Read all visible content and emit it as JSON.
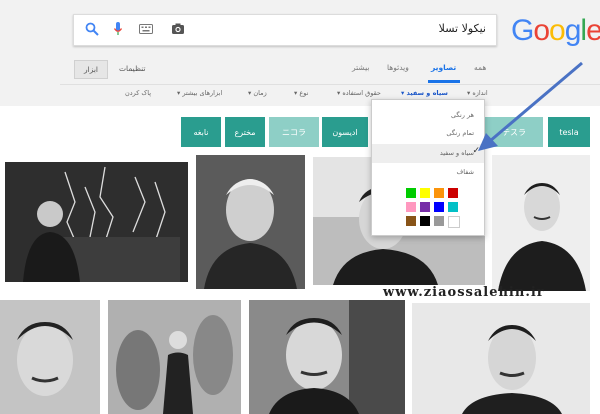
{
  "search": {
    "query": "نیکولا تسلا"
  },
  "logo": {
    "text": "Google"
  },
  "tabs": [
    {
      "label": "همه"
    },
    {
      "label": "تصاویر"
    },
    {
      "label": "ویدئوها"
    },
    {
      "label": "بیشتر"
    }
  ],
  "settings_label": "تنظیمات",
  "tools_label": "ابزار",
  "tools_row": [
    {
      "label": "اندازه ▾"
    },
    {
      "label": "سیاه و سفید ▾"
    },
    {
      "label": "حقوق استفاده ▾"
    },
    {
      "label": "نوع ▾"
    },
    {
      "label": "زمان ▾"
    },
    {
      "label": "ابزارهای بیشتر ▾"
    },
    {
      "label": "پاک کردن"
    }
  ],
  "chips": [
    {
      "label": "tesla"
    },
    {
      "label": "テスラ"
    },
    {
      "label": "ادیسون"
    },
    {
      "label": "ニコラ"
    },
    {
      "label": "مخترع"
    },
    {
      "label": "نابغه"
    }
  ],
  "dropdown": {
    "items": [
      {
        "label": "هر رنگی"
      },
      {
        "label": "تمام رنگی"
      },
      {
        "label": "سیاه و سفید"
      },
      {
        "label": "شفاف"
      }
    ],
    "checkmark": "✓",
    "swatches": [
      {
        "color": "#cc0000"
      },
      {
        "color": "#fb940b"
      },
      {
        "color": "#ffff00"
      },
      {
        "color": "#00cc00"
      },
      {
        "color": "#03c0c6"
      },
      {
        "color": "#0000ff"
      },
      {
        "color": "#762ca7"
      },
      {
        "color": "#ff98bf"
      },
      {
        "color": "#ffffff"
      },
      {
        "color": "#999999"
      },
      {
        "color": "#000000"
      },
      {
        "color": "#885418"
      }
    ]
  },
  "watermark": "www.ziaossalehin.ir",
  "colors": {
    "accent": "#1a73e8",
    "chip": "#2a9d8f",
    "arrow": "#4a72c4"
  }
}
